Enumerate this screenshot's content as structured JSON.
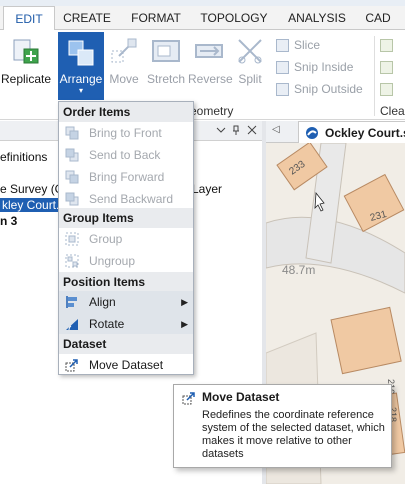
{
  "ribbon": {
    "tabs": [
      "EDIT",
      "CREATE",
      "FORMAT",
      "TOPOLOGY",
      "ANALYSIS",
      "CAD"
    ],
    "active_tab": "EDIT",
    "buttons": {
      "replicate": "Replicate",
      "arrange": "Arrange",
      "move": "Move",
      "stretch": "Stretch",
      "reverse": "Reverse",
      "split": "Split"
    },
    "small_buttons": {
      "slice": "Slice",
      "snip_inside": "Snip Inside",
      "snip_outside": "Snip Outside"
    },
    "group_label": "eometry",
    "clear_label": "Clear"
  },
  "left_panel": {
    "row1": "efinitions",
    "row2_left": "e Survey (GE",
    "row2_right": "Layer",
    "row3_selected": "kley Court.dw",
    "row4": "n 3"
  },
  "map": {
    "tab_title": "Ockley Court.sv",
    "labels": {
      "building_233": "233",
      "building_231": "231",
      "elevation": "48.7m",
      "rotated_216": "216",
      "rotated_218": "218"
    }
  },
  "menu": {
    "sections": {
      "order": "Order Items",
      "group": "Group Items",
      "position": "Position Items",
      "dataset": "Dataset"
    },
    "items": {
      "bring_to_front": "Bring to Front",
      "send_to_back": "Send to Back",
      "bring_forward": "Bring Forward",
      "send_backward": "Send Backward",
      "group": "Group",
      "ungroup": "Ungroup",
      "align": "Align",
      "rotate": "Rotate",
      "move_dataset": "Move Dataset"
    }
  },
  "tooltip": {
    "title": "Move Dataset",
    "body": "Redefines the coordinate reference system of the selected dataset, which makes it move relative to other datasets"
  },
  "colors": {
    "accent": "#1f5fb2",
    "disabled": "#9aa0a8"
  }
}
